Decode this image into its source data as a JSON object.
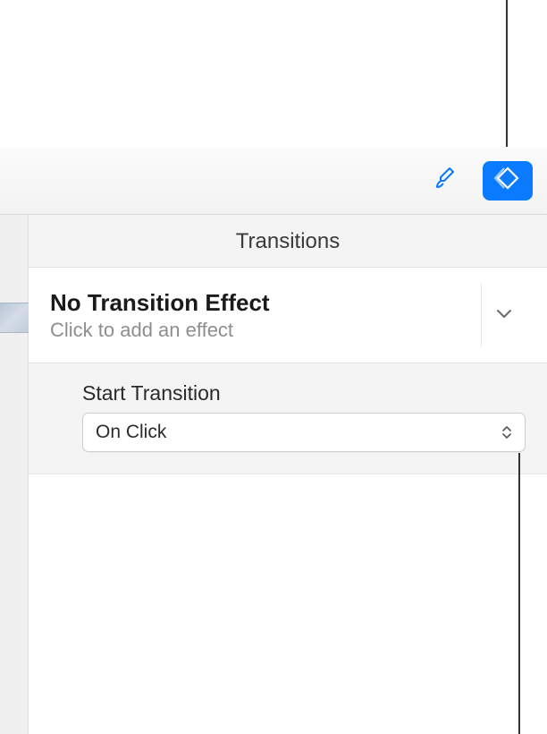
{
  "panel": {
    "header": "Transitions"
  },
  "effect": {
    "title": "No Transition Effect",
    "subtitle": "Click to add an effect"
  },
  "settings": {
    "startTransition": {
      "label": "Start Transition",
      "value": "On Click"
    }
  }
}
